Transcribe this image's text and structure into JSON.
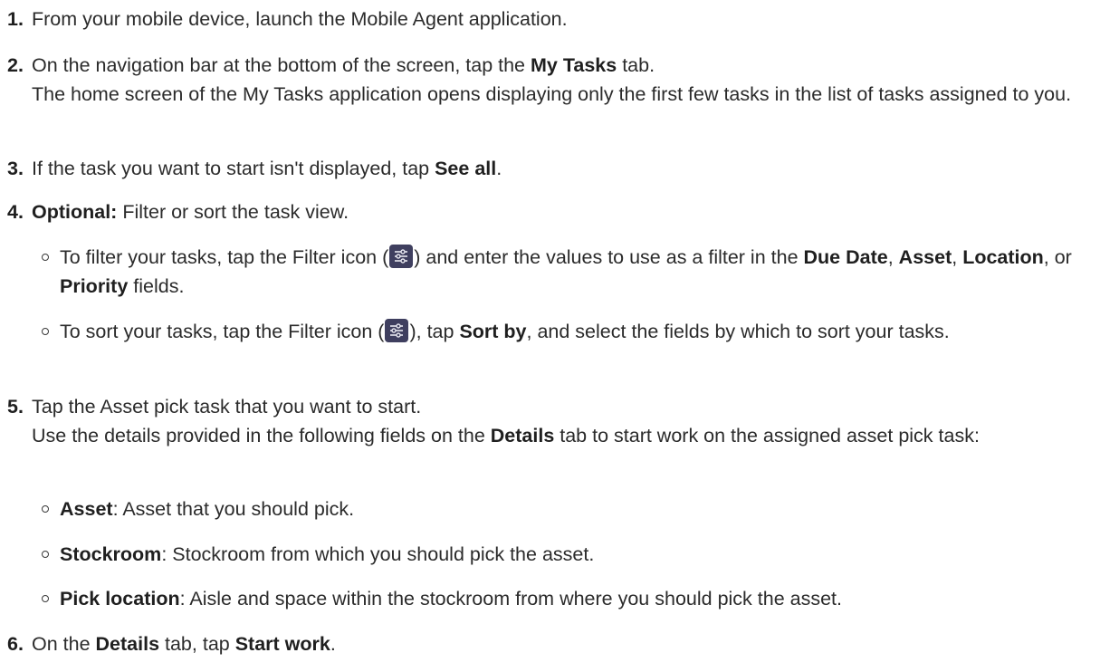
{
  "steps": [
    {
      "num": "1.",
      "text": "From your mobile device, launch the Mobile Agent application."
    },
    {
      "num": "2.",
      "pre": "On the navigation bar at the bottom of the screen, tap the ",
      "b1": "My Tasks",
      "post": " tab.",
      "note": "The home screen of the My Tasks application opens displaying only the first few tasks in the list of tasks assigned to you."
    },
    {
      "num": "3.",
      "pre": "If the task you want to start isn't displayed, tap ",
      "b1": "See all",
      "post": "."
    },
    {
      "num": "4.",
      "b1": "Optional:",
      "post": " Filter or sort the task view."
    },
    {
      "num": "5.",
      "text": "Tap the Asset pick task that you want to start.",
      "note_pre": "Use the details provided in the following fields on the ",
      "note_b": "Details",
      "note_post": " tab to start work on the assigned asset pick task:"
    },
    {
      "num": "6.",
      "pre": "On the ",
      "b1": "Details",
      "mid": " tab, tap ",
      "b2": "Start work",
      "post": "."
    }
  ],
  "filter_bullet": {
    "pre": "To filter your tasks, tap the Filter icon (",
    "after_icon": ") and enter the values to use as a filter in the ",
    "b1": "Due Date",
    "s1": ", ",
    "b2": "Asset",
    "s2": ", ",
    "b3": "Location",
    "s3": ", or ",
    "b4": "Priority",
    "post": " fields."
  },
  "sort_bullet": {
    "pre": "To sort your tasks, tap the Filter icon (",
    "after_icon": "), tap ",
    "b1": "Sort by",
    "post": ", and select the fields by which to sort your tasks."
  },
  "fields": [
    {
      "name": "Asset",
      "desc": ": Asset that you should pick."
    },
    {
      "name": "Stockroom",
      "desc": ": Stockroom from which you should pick the asset."
    },
    {
      "name": "Pick location",
      "desc": ": Aisle and space within the stockroom from where you should pick the asset."
    }
  ],
  "icons": {
    "filter": "filter-sliders-icon"
  },
  "colors": {
    "icon_bg": "#3f3f5f",
    "text": "#2b2b2b"
  }
}
